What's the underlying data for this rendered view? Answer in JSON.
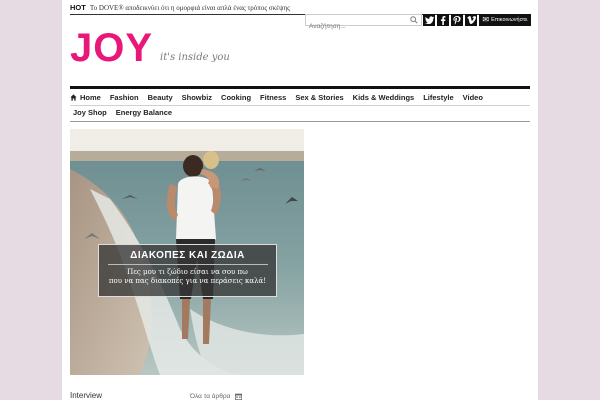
{
  "topbar": {
    "hot_label": "HOT",
    "hot_text": "Το DOVE® αποδεικνύει ότι η ομορφιά είναι απλά ένας τρόπος σκέψης"
  },
  "search": {
    "placeholder": "Αναζήτηση..."
  },
  "social": {
    "twitter": "twitter-icon",
    "facebook": "facebook-icon",
    "pinterest": "pinterest-icon",
    "vimeo": "vimeo-icon",
    "contact_label": "Επικοινωνήστε"
  },
  "logo": {
    "text": "JOY",
    "tagline": "it's inside you",
    "brand_color": "#e8187a"
  },
  "nav": {
    "items": [
      {
        "label": "Home"
      },
      {
        "label": "Fashion"
      },
      {
        "label": "Beauty"
      },
      {
        "label": "Showbiz"
      },
      {
        "label": "Cooking"
      },
      {
        "label": "Fitness"
      },
      {
        "label": "Sex & Stories"
      },
      {
        "label": "Kids & Weddings"
      },
      {
        "label": "Lifestyle"
      },
      {
        "label": "Video"
      }
    ],
    "items_row2": [
      {
        "label": "Joy Shop"
      },
      {
        "label": "Energy Balance"
      }
    ]
  },
  "hero": {
    "title": "ΔΙΑΚΟΠΕΣ ΚΑΙ ΖΩΔΙΑ",
    "line1": "Πες μου τι ζώδιο είσαι να σου πω",
    "line2": "που να πας διακοπές για να περάσεις καλά!"
  },
  "section": {
    "label": "Interview",
    "all_articles": "Όλα τα άρθρα"
  }
}
